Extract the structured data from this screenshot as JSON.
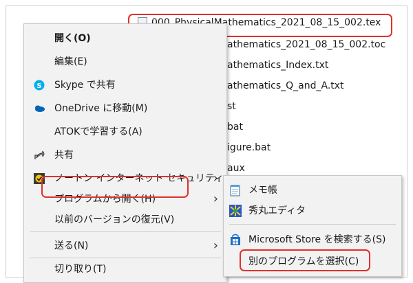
{
  "files": [
    "000_PhysicalMathematics_2021_08_15_002.tex",
    "athematics_2021_08_15_002.toc",
    "athematics_Index.txt",
    "athematics_Q_and_A.txt",
    "st",
    "bat",
    "igure.bat",
    "aux"
  ],
  "context_menu": {
    "open": "開く(O)",
    "edit": "編集(E)",
    "skype": "Skype で共有",
    "onedrive": "OneDrive に移動(M)",
    "atok": "ATOKで学習する(A)",
    "share": "共有",
    "norton": "ノートン インターネット セキュリティ",
    "open_with": "プログラムから開く(H)",
    "restore": "以前のバージョンの復元(V)",
    "send_to": "送る(N)",
    "cut": "切り取り(T)"
  },
  "submenu": {
    "notepad": "メモ帳",
    "hidemaru": "秀丸エディタ",
    "store": "Microsoft Store を検索する(S)",
    "choose": "別のプログラムを選択(C)"
  },
  "icons": {
    "skype": "skype-icon",
    "onedrive": "onedrive-icon",
    "share": "share-icon",
    "norton": "norton-icon",
    "notepad": "notepad-icon",
    "hidemaru": "hidemaru-icon",
    "store": "store-icon"
  },
  "colors": {
    "highlight": "#e0302a",
    "skype": "#00aff0",
    "onedrive": "#0364b8",
    "norton": "#f5c400",
    "store": "#1f6fc5"
  }
}
